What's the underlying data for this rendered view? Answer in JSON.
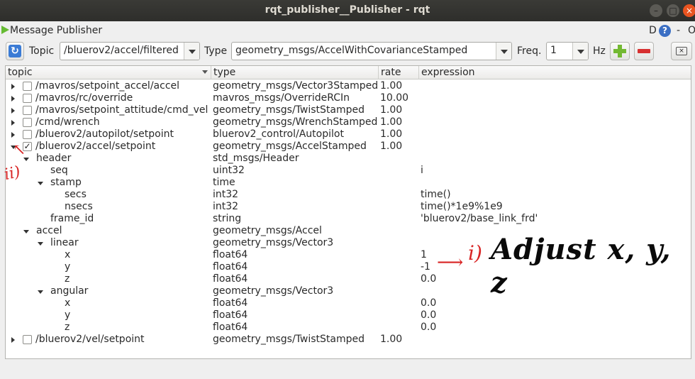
{
  "window": {
    "title": "rqt_publisher__Publisher - rqt",
    "controls": [
      "–",
      "□",
      "×"
    ]
  },
  "plugin": {
    "title": "Message Publisher",
    "d_label": "D",
    "help_label": "?",
    "dash_label": "-",
    "o_label": "O"
  },
  "toolbar": {
    "topic_label": "Topic",
    "topic_value": "/bluerov2/accel/filtered",
    "type_label": "Type",
    "type_value": "geometry_msgs/AccelWithCovarianceStamped",
    "freq_label": "Freq.",
    "freq_value": "1",
    "hz_label": "Hz",
    "refresh_icon": "refresh-icon",
    "add_icon": "plus-icon",
    "remove_icon": "minus-icon",
    "clear_icon": "clear-icon",
    "add_color": "#73b932",
    "remove_color": "#d73030"
  },
  "table": {
    "headers": [
      "topic",
      "type",
      "rate",
      "expression"
    ],
    "rows": [
      {
        "topic": "/mavros/setpoint_accel/accel",
        "type": "geometry_msgs/Vector3Stamped",
        "rate": "1.00",
        "expression": "",
        "checked": false,
        "expander": "closed"
      },
      {
        "topic": "/mavros/rc/override",
        "type": "mavros_msgs/OverrideRCIn",
        "rate": "10.00",
        "expression": "",
        "checked": false,
        "expander": "closed"
      },
      {
        "topic": "/mavros/setpoint_attitude/cmd_vel",
        "type": "geometry_msgs/TwistStamped",
        "rate": "1.00",
        "expression": "",
        "checked": false,
        "expander": "closed"
      },
      {
        "topic": "/cmd/wrench",
        "type": "geometry_msgs/WrenchStamped",
        "rate": "1.00",
        "expression": "",
        "checked": false,
        "expander": "closed"
      },
      {
        "topic": "/bluerov2/autopilot/setpoint",
        "type": "bluerov2_control/Autopilot",
        "rate": "1.00",
        "expression": "",
        "checked": false,
        "expander": "closed"
      },
      {
        "topic": "/bluerov2/accel/setpoint",
        "type": "geometry_msgs/AccelStamped",
        "rate": "1.00",
        "expression": "",
        "checked": true,
        "expander": "open"
      },
      {
        "topic": "header",
        "type": "std_msgs/Header",
        "rate": "",
        "expression": "",
        "expander": "open"
      },
      {
        "topic": "seq",
        "type": "uint32",
        "rate": "",
        "expression": "i"
      },
      {
        "topic": "stamp",
        "type": "time",
        "rate": "",
        "expression": "",
        "expander": "open"
      },
      {
        "topic": "secs",
        "type": "int32",
        "rate": "",
        "expression": "time()"
      },
      {
        "topic": "nsecs",
        "type": "int32",
        "rate": "",
        "expression": "time()*1e9%1e9"
      },
      {
        "topic": "frame_id",
        "type": "string",
        "rate": "",
        "expression": "'bluerov2/base_link_frd'"
      },
      {
        "topic": "accel",
        "type": "geometry_msgs/Accel",
        "rate": "",
        "expression": "",
        "expander": "open"
      },
      {
        "topic": "linear",
        "type": "geometry_msgs/Vector3",
        "rate": "",
        "expression": "",
        "expander": "open"
      },
      {
        "topic": "x",
        "type": "float64",
        "rate": "",
        "expression": "1"
      },
      {
        "topic": "y",
        "type": "float64",
        "rate": "",
        "expression": "-1"
      },
      {
        "topic": "z",
        "type": "float64",
        "rate": "",
        "expression": "0.0"
      },
      {
        "topic": "angular",
        "type": "geometry_msgs/Vector3",
        "rate": "",
        "expression": "",
        "expander": "open"
      },
      {
        "topic": "x",
        "type": "float64",
        "rate": "",
        "expression": "0.0"
      },
      {
        "topic": "y",
        "type": "float64",
        "rate": "",
        "expression": "0.0"
      },
      {
        "topic": "z",
        "type": "float64",
        "rate": "",
        "expression": "0.0"
      },
      {
        "topic": "/bluerov2/vel/setpoint",
        "type": "geometry_msgs/TwistStamped",
        "rate": "1.00",
        "expression": "",
        "checked": false,
        "expander": "closed"
      }
    ]
  },
  "annotations": {
    "label_one": "i)",
    "label_two": "ii)",
    "note": "Adjust x, y, z",
    "annotation_color": "#d82424"
  }
}
